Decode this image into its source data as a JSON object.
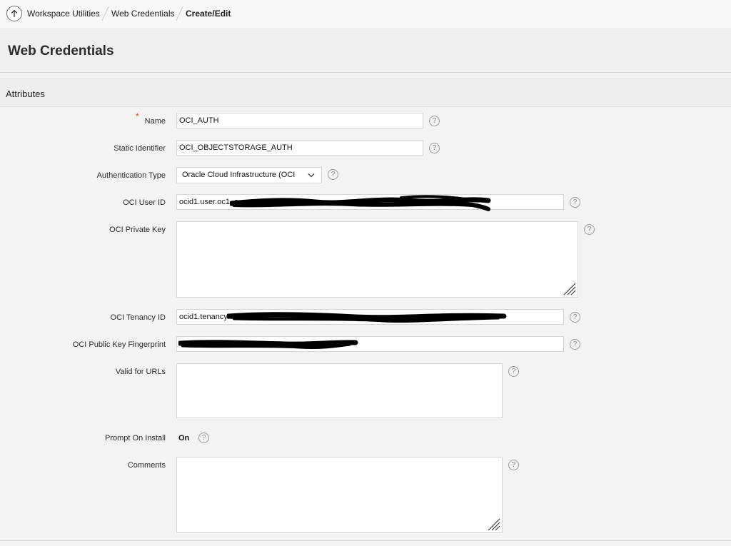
{
  "breadcrumb": {
    "items": [
      "Workspace Utilities",
      "Web Credentials"
    ],
    "current": "Create/Edit"
  },
  "page": {
    "title": "Web Credentials"
  },
  "region": {
    "title": "Attributes"
  },
  "form": {
    "name": {
      "label": "Name",
      "required_mark": "*",
      "value": "OCI_AUTH"
    },
    "static_identifier": {
      "label": "Static Identifier",
      "value": "OCI_OBJECTSTORAGE_AUTH"
    },
    "authentication_type": {
      "label": "Authentication Type",
      "selected": "Oracle Cloud Infrastructure (OCI"
    },
    "oci_user_id": {
      "label": "OCI User ID",
      "value": "ocid1.user.oc1..a"
    },
    "oci_private_key": {
      "label": "OCI Private Key",
      "value": ""
    },
    "oci_tenancy_id": {
      "label": "OCI Tenancy ID",
      "value": "ocid1.tenancy.o"
    },
    "oci_public_key_fingerprint": {
      "label": "OCI Public Key Fingerprint",
      "value": ""
    },
    "valid_for_urls": {
      "label": "Valid for URLs",
      "value": ""
    },
    "prompt_on_install": {
      "label": "Prompt On Install",
      "value": "On"
    },
    "comments": {
      "label": "Comments",
      "value": ""
    },
    "help_glyph": "?"
  },
  "colors": {
    "background": "#f4f3f1",
    "required": "#c74634",
    "field_border": "#d9d7d3"
  }
}
